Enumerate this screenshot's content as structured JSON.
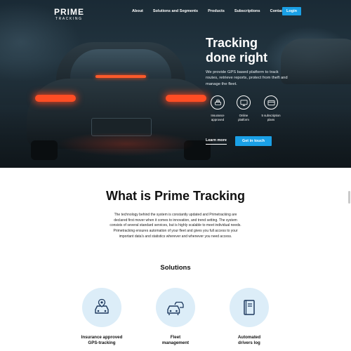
{
  "nav": {
    "logo_main": "PRIME",
    "logo_sub": "TRACKING",
    "links": [
      "About",
      "Solutions and Segments",
      "Products",
      "Subscriptions",
      "Contact"
    ],
    "login_label": "Login"
  },
  "hero": {
    "title_line1": "Tracking",
    "title_line2": "done right",
    "description": "We provide GPS based platform to track routes, retrieve reports, protect from theft and manage the fleet.",
    "features": [
      {
        "icon": "car-shield-icon",
        "line1": "Insurance",
        "line2": "approved"
      },
      {
        "icon": "monitor-icon",
        "line1": "Online",
        "line2": "platform"
      },
      {
        "icon": "credit-card-icon",
        "line1": "5 subscription",
        "line2": "plans"
      }
    ],
    "learn_more_label": "Learn more",
    "get_in_touch_label": "Get in touch"
  },
  "what": {
    "title": "What is Prime Tracking",
    "description": "The technology behind the system is constantly updated and Primetracking are declared first mover when it comes to innovation, and trend setting. The system consists of several standard services, but is highly scalable to meet individual needs. Primetracking ensures automation of your fleet and gives you full access to your important data's and statistics wherever and whenever you need access."
  },
  "solutions": {
    "title": "Solutions",
    "items": [
      {
        "icon": "car-location-icon",
        "line1": "Insurance approved",
        "line2": "GPS-tracking"
      },
      {
        "icon": "fleet-cars-icon",
        "line1": "Fleet",
        "line2": "management"
      },
      {
        "icon": "logbook-icon",
        "line1": "Automated",
        "line2": "drivers log"
      }
    ]
  },
  "colors": {
    "accent": "#1aa0e6",
    "solution_circle": "#dcedf8"
  }
}
